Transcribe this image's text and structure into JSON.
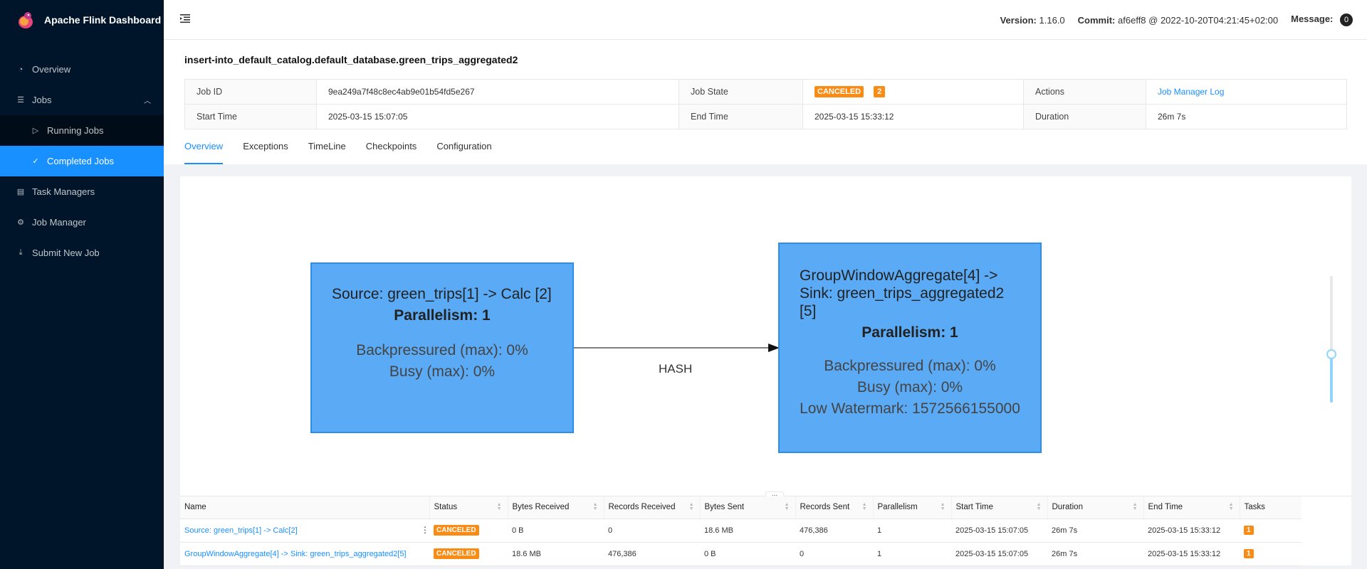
{
  "app": {
    "title": "Apache Flink Dashboard"
  },
  "sidebar": {
    "items": [
      {
        "label": "Overview",
        "icon": "dashboard-icon"
      },
      {
        "label": "Jobs",
        "icon": "list-icon"
      },
      {
        "label": "Running Jobs",
        "icon": "play-circle-icon"
      },
      {
        "label": "Completed Jobs",
        "icon": "check-circle-icon"
      },
      {
        "label": "Task Managers",
        "icon": "schedule-icon"
      },
      {
        "label": "Job Manager",
        "icon": "build-icon"
      },
      {
        "label": "Submit New Job",
        "icon": "upload-icon"
      }
    ]
  },
  "header": {
    "version_label": "Version:",
    "version_value": "1.16.0",
    "commit_label": "Commit:",
    "commit_value": "af6eff8 @ 2022-10-20T04:21:45+02:00",
    "message_label": "Message:",
    "message_count": "0"
  },
  "job": {
    "name": "insert-into_default_catalog.default_database.green_trips_aggregated2",
    "job_id_label": "Job ID",
    "job_id": "9ea249a7f48c8ec4ab9e01b54fd5e267",
    "job_state_label": "Job State",
    "job_state": "CANCELED",
    "job_state_count": "2",
    "actions_label": "Actions",
    "actions_link": "Job Manager Log",
    "start_time_label": "Start Time",
    "start_time": "2025-03-15 15:07:05",
    "end_time_label": "End Time",
    "end_time": "2025-03-15 15:33:12",
    "duration_label": "Duration",
    "duration": "26m 7s"
  },
  "tabs": [
    "Overview",
    "Exceptions",
    "TimeLine",
    "Checkpoints",
    "Configuration"
  ],
  "graph": {
    "nodes": [
      {
        "name": "Source: green_trips[1] -> Calc [2]",
        "parallelism": "Parallelism: 1",
        "backpressured": "Backpressured (max): 0%",
        "busy": "Busy (max): 0%"
      },
      {
        "name": "GroupWindowAggregate[4] -> Sink: green_trips_aggregated2 [5]",
        "parallelism": "Parallelism: 1",
        "backpressured": "Backpressured (max): 0%",
        "busy": "Busy (max): 0%",
        "watermark": "Low Watermark: 1572566155000"
      }
    ],
    "edge_label": "HASH",
    "zoom_level": 0.38
  },
  "vertex_table": {
    "columns": [
      "Name",
      "Status",
      "Bytes Received",
      "Records Received",
      "Bytes Sent",
      "Records Sent",
      "Parallelism",
      "Start Time",
      "Duration",
      "End Time",
      "Tasks"
    ],
    "rows": [
      {
        "name": "Source: green_trips[1] -> Calc[2]",
        "status": "CANCELED",
        "bytes_received": "0 B",
        "records_received": "0",
        "bytes_sent": "18.6 MB",
        "records_sent": "476,386",
        "parallelism": "1",
        "start_time": "2025-03-15 15:07:05",
        "duration": "26m 7s",
        "end_time": "2025-03-15 15:33:12",
        "tasks": "1"
      },
      {
        "name": "GroupWindowAggregate[4] -> Sink: green_trips_aggregated2[5]",
        "status": "CANCELED",
        "bytes_received": "18.6 MB",
        "records_received": "476,386",
        "bytes_sent": "0 B",
        "records_sent": "0",
        "parallelism": "1",
        "start_time": "2025-03-15 15:07:05",
        "duration": "26m 7s",
        "end_time": "2025-03-15 15:33:12",
        "tasks": "1"
      }
    ]
  },
  "colors": {
    "sidebar_bg": "#001529",
    "accent": "#1890ff",
    "canceled": "#fa8c16",
    "node_fill": "#5aaaf5"
  }
}
